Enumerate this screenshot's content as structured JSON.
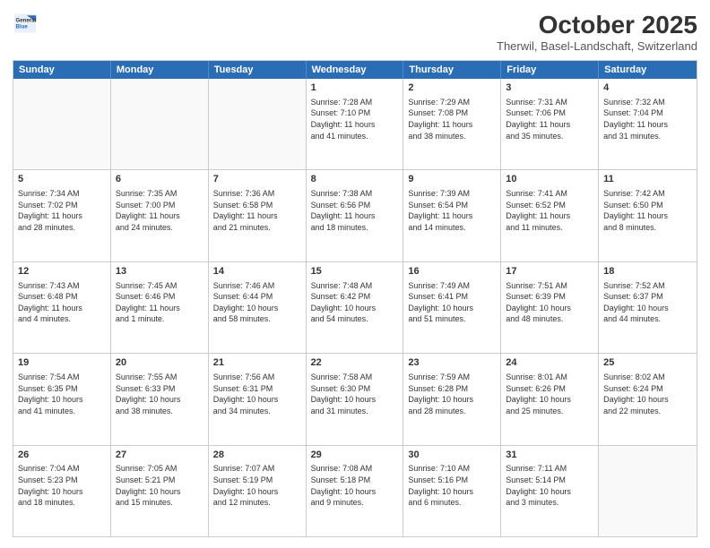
{
  "header": {
    "logo_line1": "General",
    "logo_line2": "Blue",
    "title": "October 2025",
    "subtitle": "Therwil, Basel-Landschaft, Switzerland"
  },
  "days_of_week": [
    "Sunday",
    "Monday",
    "Tuesday",
    "Wednesday",
    "Thursday",
    "Friday",
    "Saturday"
  ],
  "weeks": [
    [
      {
        "day": "",
        "empty": true
      },
      {
        "day": "",
        "empty": true
      },
      {
        "day": "",
        "empty": true
      },
      {
        "day": "1",
        "line1": "Sunrise: 7:28 AM",
        "line2": "Sunset: 7:10 PM",
        "line3": "Daylight: 11 hours",
        "line4": "and 41 minutes."
      },
      {
        "day": "2",
        "line1": "Sunrise: 7:29 AM",
        "line2": "Sunset: 7:08 PM",
        "line3": "Daylight: 11 hours",
        "line4": "and 38 minutes."
      },
      {
        "day": "3",
        "line1": "Sunrise: 7:31 AM",
        "line2": "Sunset: 7:06 PM",
        "line3": "Daylight: 11 hours",
        "line4": "and 35 minutes."
      },
      {
        "day": "4",
        "line1": "Sunrise: 7:32 AM",
        "line2": "Sunset: 7:04 PM",
        "line3": "Daylight: 11 hours",
        "line4": "and 31 minutes."
      }
    ],
    [
      {
        "day": "5",
        "line1": "Sunrise: 7:34 AM",
        "line2": "Sunset: 7:02 PM",
        "line3": "Daylight: 11 hours",
        "line4": "and 28 minutes."
      },
      {
        "day": "6",
        "line1": "Sunrise: 7:35 AM",
        "line2": "Sunset: 7:00 PM",
        "line3": "Daylight: 11 hours",
        "line4": "and 24 minutes."
      },
      {
        "day": "7",
        "line1": "Sunrise: 7:36 AM",
        "line2": "Sunset: 6:58 PM",
        "line3": "Daylight: 11 hours",
        "line4": "and 21 minutes."
      },
      {
        "day": "8",
        "line1": "Sunrise: 7:38 AM",
        "line2": "Sunset: 6:56 PM",
        "line3": "Daylight: 11 hours",
        "line4": "and 18 minutes."
      },
      {
        "day": "9",
        "line1": "Sunrise: 7:39 AM",
        "line2": "Sunset: 6:54 PM",
        "line3": "Daylight: 11 hours",
        "line4": "and 14 minutes."
      },
      {
        "day": "10",
        "line1": "Sunrise: 7:41 AM",
        "line2": "Sunset: 6:52 PM",
        "line3": "Daylight: 11 hours",
        "line4": "and 11 minutes."
      },
      {
        "day": "11",
        "line1": "Sunrise: 7:42 AM",
        "line2": "Sunset: 6:50 PM",
        "line3": "Daylight: 11 hours",
        "line4": "and 8 minutes."
      }
    ],
    [
      {
        "day": "12",
        "line1": "Sunrise: 7:43 AM",
        "line2": "Sunset: 6:48 PM",
        "line3": "Daylight: 11 hours",
        "line4": "and 4 minutes."
      },
      {
        "day": "13",
        "line1": "Sunrise: 7:45 AM",
        "line2": "Sunset: 6:46 PM",
        "line3": "Daylight: 11 hours",
        "line4": "and 1 minute."
      },
      {
        "day": "14",
        "line1": "Sunrise: 7:46 AM",
        "line2": "Sunset: 6:44 PM",
        "line3": "Daylight: 10 hours",
        "line4": "and 58 minutes."
      },
      {
        "day": "15",
        "line1": "Sunrise: 7:48 AM",
        "line2": "Sunset: 6:42 PM",
        "line3": "Daylight: 10 hours",
        "line4": "and 54 minutes."
      },
      {
        "day": "16",
        "line1": "Sunrise: 7:49 AM",
        "line2": "Sunset: 6:41 PM",
        "line3": "Daylight: 10 hours",
        "line4": "and 51 minutes."
      },
      {
        "day": "17",
        "line1": "Sunrise: 7:51 AM",
        "line2": "Sunset: 6:39 PM",
        "line3": "Daylight: 10 hours",
        "line4": "and 48 minutes."
      },
      {
        "day": "18",
        "line1": "Sunrise: 7:52 AM",
        "line2": "Sunset: 6:37 PM",
        "line3": "Daylight: 10 hours",
        "line4": "and 44 minutes."
      }
    ],
    [
      {
        "day": "19",
        "line1": "Sunrise: 7:54 AM",
        "line2": "Sunset: 6:35 PM",
        "line3": "Daylight: 10 hours",
        "line4": "and 41 minutes."
      },
      {
        "day": "20",
        "line1": "Sunrise: 7:55 AM",
        "line2": "Sunset: 6:33 PM",
        "line3": "Daylight: 10 hours",
        "line4": "and 38 minutes."
      },
      {
        "day": "21",
        "line1": "Sunrise: 7:56 AM",
        "line2": "Sunset: 6:31 PM",
        "line3": "Daylight: 10 hours",
        "line4": "and 34 minutes."
      },
      {
        "day": "22",
        "line1": "Sunrise: 7:58 AM",
        "line2": "Sunset: 6:30 PM",
        "line3": "Daylight: 10 hours",
        "line4": "and 31 minutes."
      },
      {
        "day": "23",
        "line1": "Sunrise: 7:59 AM",
        "line2": "Sunset: 6:28 PM",
        "line3": "Daylight: 10 hours",
        "line4": "and 28 minutes."
      },
      {
        "day": "24",
        "line1": "Sunrise: 8:01 AM",
        "line2": "Sunset: 6:26 PM",
        "line3": "Daylight: 10 hours",
        "line4": "and 25 minutes."
      },
      {
        "day": "25",
        "line1": "Sunrise: 8:02 AM",
        "line2": "Sunset: 6:24 PM",
        "line3": "Daylight: 10 hours",
        "line4": "and 22 minutes."
      }
    ],
    [
      {
        "day": "26",
        "line1": "Sunrise: 7:04 AM",
        "line2": "Sunset: 5:23 PM",
        "line3": "Daylight: 10 hours",
        "line4": "and 18 minutes."
      },
      {
        "day": "27",
        "line1": "Sunrise: 7:05 AM",
        "line2": "Sunset: 5:21 PM",
        "line3": "Daylight: 10 hours",
        "line4": "and 15 minutes."
      },
      {
        "day": "28",
        "line1": "Sunrise: 7:07 AM",
        "line2": "Sunset: 5:19 PM",
        "line3": "Daylight: 10 hours",
        "line4": "and 12 minutes."
      },
      {
        "day": "29",
        "line1": "Sunrise: 7:08 AM",
        "line2": "Sunset: 5:18 PM",
        "line3": "Daylight: 10 hours",
        "line4": "and 9 minutes."
      },
      {
        "day": "30",
        "line1": "Sunrise: 7:10 AM",
        "line2": "Sunset: 5:16 PM",
        "line3": "Daylight: 10 hours",
        "line4": "and 6 minutes."
      },
      {
        "day": "31",
        "line1": "Sunrise: 7:11 AM",
        "line2": "Sunset: 5:14 PM",
        "line3": "Daylight: 10 hours",
        "line4": "and 3 minutes."
      },
      {
        "day": "",
        "empty": true
      }
    ]
  ]
}
